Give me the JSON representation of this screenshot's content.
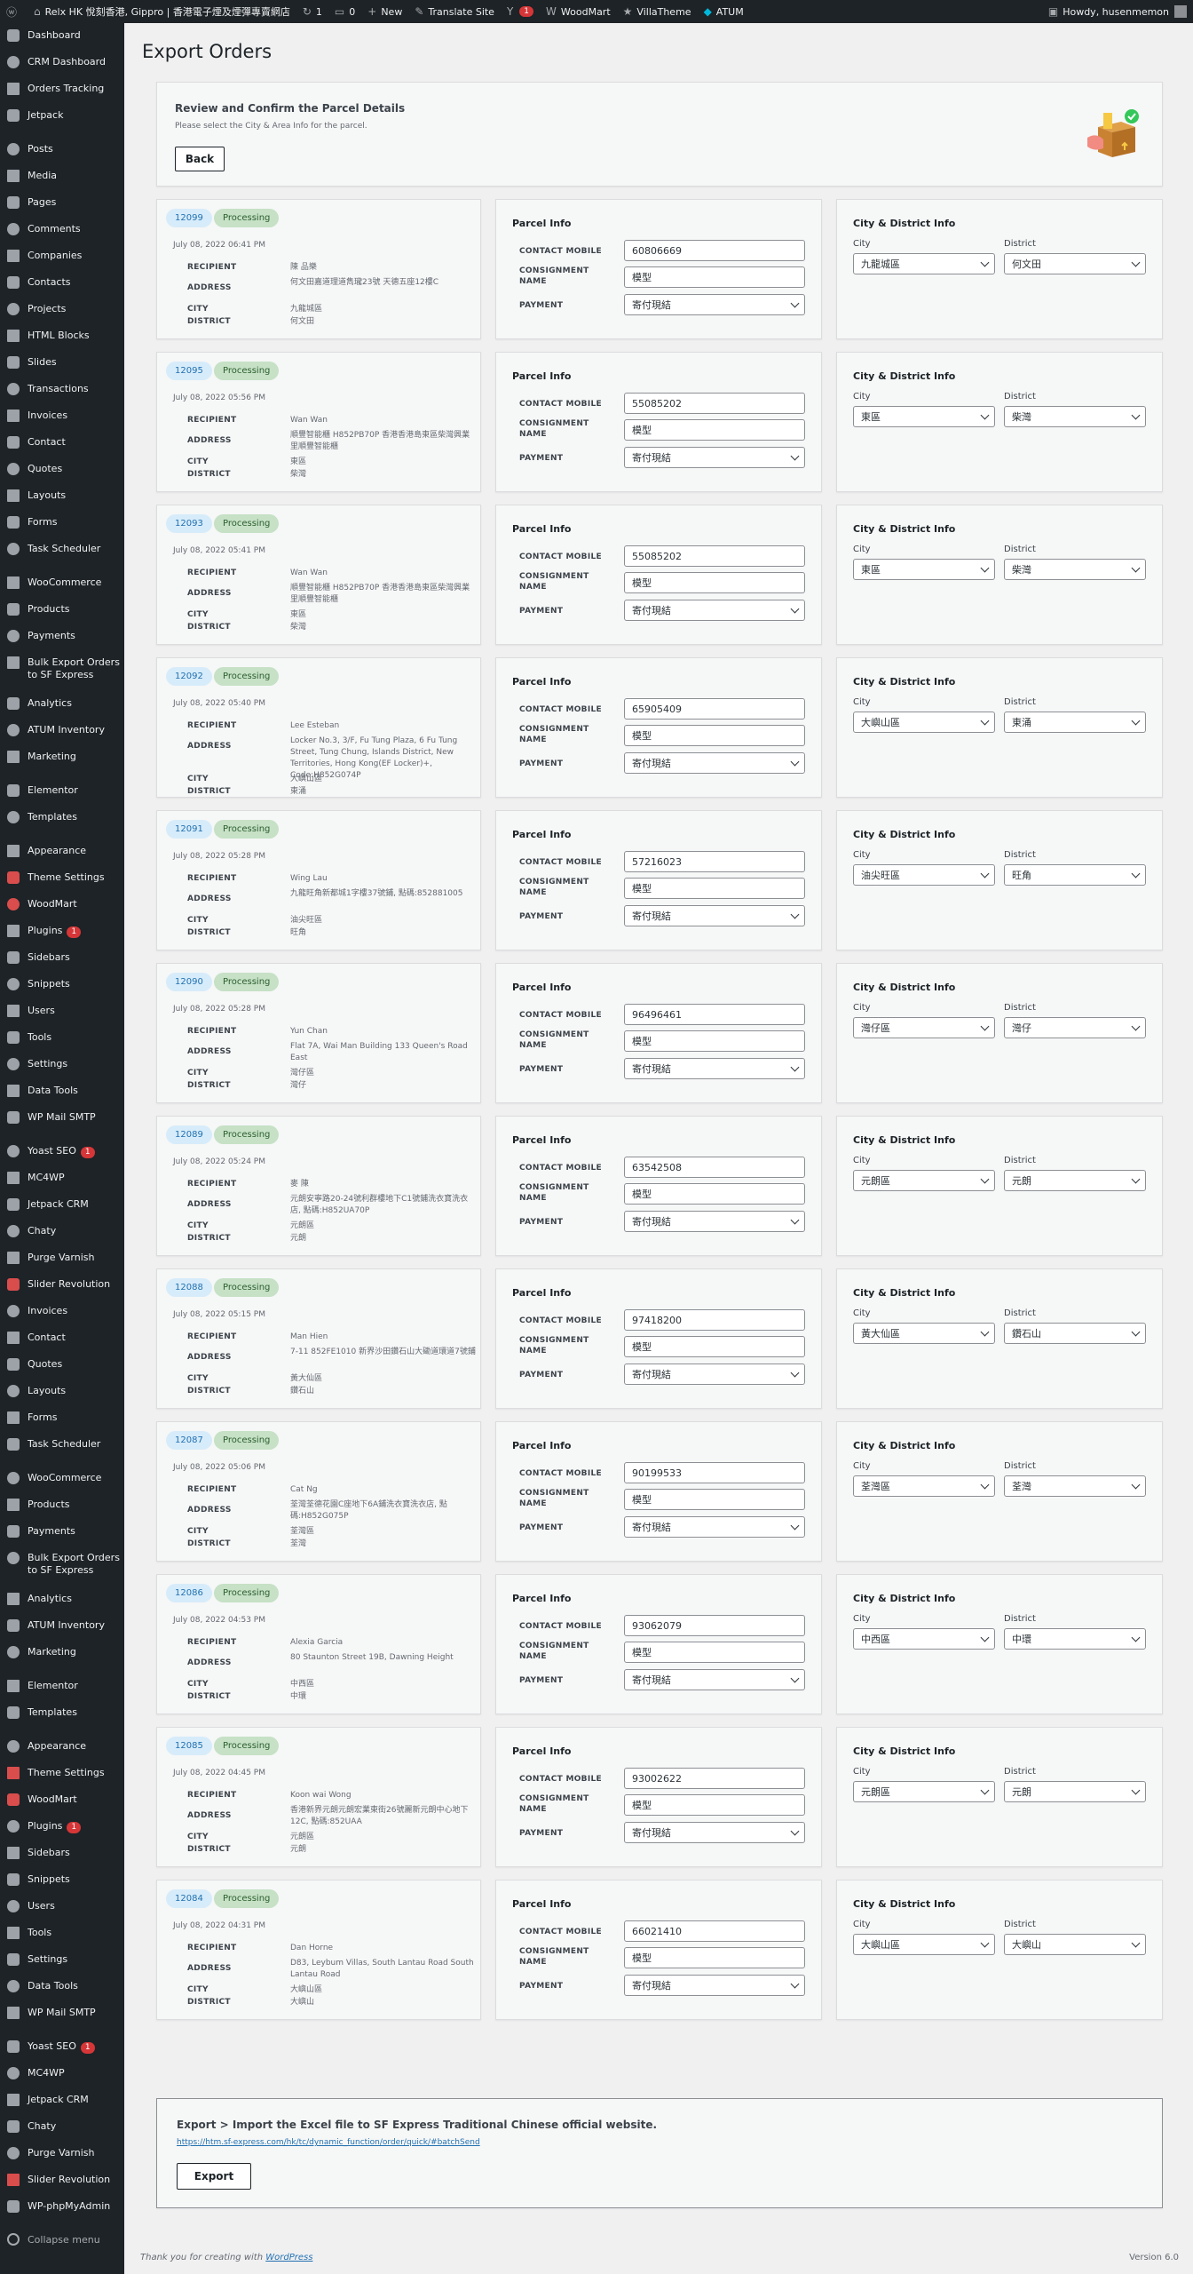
{
  "adminbar": {
    "site_name": "Relx HK 悅刻香港, Gippro | 香港電子煙及煙彈專賣網店",
    "updates_count": "1",
    "comments_count": "0",
    "new_label": "New",
    "translate_label": "Translate Site",
    "yoast_badge": "1",
    "woodmart_label": "WoodMart",
    "villatheme_label": "VillaTheme",
    "atum_label": "ATUM",
    "howdy": "Howdy, husenmemon"
  },
  "sidebar": {
    "items": [
      {
        "label": "Dashboard",
        "sep_before": false
      },
      {
        "label": "CRM Dashboard",
        "sep_before": false
      },
      {
        "label": "Orders Tracking",
        "sep_before": false
      },
      {
        "label": "Jetpack",
        "sep_before": false
      },
      {
        "label": "Posts",
        "sep_before": true
      },
      {
        "label": "Media",
        "sep_before": false
      },
      {
        "label": "Pages",
        "sep_before": false
      },
      {
        "label": "Comments",
        "sep_before": false
      },
      {
        "label": "Companies",
        "sep_before": false
      },
      {
        "label": "Contacts",
        "sep_before": false
      },
      {
        "label": "Projects",
        "sep_before": false
      },
      {
        "label": "HTML Blocks",
        "sep_before": false
      },
      {
        "label": "Slides",
        "sep_before": false
      },
      {
        "label": "Transactions",
        "sep_before": false
      },
      {
        "label": "Invoices",
        "sep_before": false
      },
      {
        "label": "Contact",
        "sep_before": false
      },
      {
        "label": "Quotes",
        "sep_before": false
      },
      {
        "label": "Layouts",
        "sep_before": false
      },
      {
        "label": "Forms",
        "sep_before": false
      },
      {
        "label": "Task Scheduler",
        "sep_before": false
      },
      {
        "label": "WooCommerce",
        "sep_before": true
      },
      {
        "label": "Products",
        "sep_before": false
      },
      {
        "label": "Payments",
        "sep_before": false
      },
      {
        "label": "Bulk Export Orders to SF Express",
        "sep_before": false,
        "tall": true
      },
      {
        "label": "Analytics",
        "sep_before": false
      },
      {
        "label": "ATUM Inventory",
        "sep_before": false
      },
      {
        "label": "Marketing",
        "sep_before": false
      },
      {
        "label": "Elementor",
        "sep_before": true
      },
      {
        "label": "Templates",
        "sep_before": false
      },
      {
        "label": "Appearance",
        "sep_before": true
      },
      {
        "label": "Theme Settings",
        "sep_before": false
      },
      {
        "label": "WoodMart",
        "sep_before": false
      },
      {
        "label": "Plugins",
        "sep_before": false,
        "badge": "1"
      },
      {
        "label": "Sidebars",
        "sep_before": false
      },
      {
        "label": "Snippets",
        "sep_before": false
      },
      {
        "label": "Users",
        "sep_before": false
      },
      {
        "label": "Tools",
        "sep_before": false
      },
      {
        "label": "Settings",
        "sep_before": false
      },
      {
        "label": "Data Tools",
        "sep_before": false
      },
      {
        "label": "WP Mail SMTP",
        "sep_before": false
      },
      {
        "label": "Yoast SEO",
        "sep_before": true,
        "badge": "1"
      },
      {
        "label": "MC4WP",
        "sep_before": false
      },
      {
        "label": "Jetpack CRM",
        "sep_before": false
      },
      {
        "label": "Chaty",
        "sep_before": false
      },
      {
        "label": "Purge Varnish",
        "sep_before": false
      },
      {
        "label": "Slider Revolution",
        "sep_before": false
      },
      {
        "label": "Invoices",
        "sep_before": false
      },
      {
        "label": "Contact",
        "sep_before": false
      },
      {
        "label": "Quotes",
        "sep_before": false
      },
      {
        "label": "Layouts",
        "sep_before": false
      },
      {
        "label": "Forms",
        "sep_before": false
      },
      {
        "label": "Task Scheduler",
        "sep_before": false
      },
      {
        "label": "WooCommerce",
        "sep_before": true
      },
      {
        "label": "Products",
        "sep_before": false
      },
      {
        "label": "Payments",
        "sep_before": false
      },
      {
        "label": "Bulk Export Orders to SF Express",
        "sep_before": false,
        "tall": true
      },
      {
        "label": "Analytics",
        "sep_before": false
      },
      {
        "label": "ATUM Inventory",
        "sep_before": false
      },
      {
        "label": "Marketing",
        "sep_before": false
      },
      {
        "label": "Elementor",
        "sep_before": true
      },
      {
        "label": "Templates",
        "sep_before": false
      },
      {
        "label": "Appearance",
        "sep_before": true
      },
      {
        "label": "Theme Settings",
        "sep_before": false
      },
      {
        "label": "WoodMart",
        "sep_before": false
      },
      {
        "label": "Plugins",
        "sep_before": false,
        "badge": "1"
      },
      {
        "label": "Sidebars",
        "sep_before": false
      },
      {
        "label": "Snippets",
        "sep_before": false
      },
      {
        "label": "Users",
        "sep_before": false
      },
      {
        "label": "Tools",
        "sep_before": false
      },
      {
        "label": "Settings",
        "sep_before": false
      },
      {
        "label": "Data Tools",
        "sep_before": false
      },
      {
        "label": "WP Mail SMTP",
        "sep_before": false
      },
      {
        "label": "Yoast SEO",
        "sep_before": true,
        "badge": "1"
      },
      {
        "label": "MC4WP",
        "sep_before": false
      },
      {
        "label": "Jetpack CRM",
        "sep_before": false
      },
      {
        "label": "Chaty",
        "sep_before": false
      },
      {
        "label": "Purge Varnish",
        "sep_before": false
      },
      {
        "label": "Slider Revolution",
        "sep_before": false
      },
      {
        "label": "WP-phpMyAdmin",
        "sep_before": false
      }
    ],
    "collapse_label": "Collapse menu"
  },
  "page": {
    "title": "Export Orders",
    "review_title": "Review and Confirm the Parcel Details",
    "review_sub": "Please select the City & Area Info for the parcel.",
    "back_label": "Back"
  },
  "labels": {
    "recipient": "RECIPIENT",
    "address": "ADDRESS",
    "city": "CITY",
    "district": "DISTRICT",
    "parcel_info": "Parcel Info",
    "contact_mobile": "CONTACT MOBILE",
    "consignment_name": "CONSIGNMENT NAME",
    "payment": "PAYMENT",
    "city_district_info": "City & District Info",
    "city_sub": "City",
    "district_sub": "District"
  },
  "orders": [
    {
      "id": "12099",
      "status": "Processing",
      "date": "July 08, 2022 06:41 PM",
      "recipient": "陳 品樂",
      "address": "何文田嘉道理道雋瓏23號 天德五座12樓C",
      "city": "九龍城區",
      "district": "何文田",
      "mobile": "60806669",
      "consignment": "模型",
      "payment": "寄付現結"
    },
    {
      "id": "12095",
      "status": "Processing",
      "date": "July 08, 2022 05:56 PM",
      "recipient": "Wan Wan",
      "address": "順豐智能櫃 H852PB70P 香港香港島東區柴灣興業里順豐智能櫃",
      "city": "東區",
      "district": "柴灣",
      "mobile": "55085202",
      "consignment": "模型",
      "payment": "寄付現結"
    },
    {
      "id": "12093",
      "status": "Processing",
      "date": "July 08, 2022 05:41 PM",
      "recipient": "Wan Wan",
      "address": "順豐智能櫃 H852PB70P 香港香港島東區柴灣興業里順豐智能櫃",
      "city": "東區",
      "district": "柴灣",
      "mobile": "55085202",
      "consignment": "模型",
      "payment": "寄付現結"
    },
    {
      "id": "12092",
      "status": "Processing",
      "date": "July 08, 2022 05:40 PM",
      "recipient": "Lee Esteban",
      "address": "Locker No.3, 3/F, Fu Tung Plaza, 6 Fu Tung Street, Tung Chung, Islands District, New Territories, Hong Kong(EF Locker)+, Code:H852G074P",
      "city": "大嶼山區",
      "district": "東涌",
      "mobile": "65905409",
      "consignment": "模型",
      "payment": "寄付現結"
    },
    {
      "id": "12091",
      "status": "Processing",
      "date": "July 08, 2022 05:28 PM",
      "recipient": "Wing Lau",
      "address": "九龍旺角新都城1字樓37號鋪, 點碼:852881005",
      "city": "油尖旺區",
      "district": "旺角",
      "mobile": "57216023",
      "consignment": "模型",
      "payment": "寄付現結"
    },
    {
      "id": "12090",
      "status": "Processing",
      "date": "July 08, 2022 05:28 PM",
      "recipient": "Yun Chan",
      "address": "Flat 7A, Wai Man Building 133 Queen's Road East",
      "city": "灣仔區",
      "district": "灣仔",
      "mobile": "96496461",
      "consignment": "模型",
      "payment": "寄付現結"
    },
    {
      "id": "12089",
      "status": "Processing",
      "date": "July 08, 2022 05:24 PM",
      "recipient": "麥 陳",
      "address": "元朗安寧路20-24號利群樓地下C1號鋪洗衣寶洗衣店, 點碼:H852UA70P",
      "city": "元朗區",
      "district": "元朗",
      "mobile": "63542508",
      "consignment": "模型",
      "payment": "寄付現結"
    },
    {
      "id": "12088",
      "status": "Processing",
      "date": "July 08, 2022 05:15 PM",
      "recipient": "Man Hien",
      "address": "7-11 852FE1010 新界沙田鑽石山大磡道環道7號鋪",
      "city": "黃大仙區",
      "district": "鑽石山",
      "mobile": "97418200",
      "consignment": "模型",
      "payment": "寄付現結"
    },
    {
      "id": "12087",
      "status": "Processing",
      "date": "July 08, 2022 05:06 PM",
      "recipient": "Cat Ng",
      "address": "荃灣荃德花園C座地下6A鋪洗衣寶洗衣店, 點碼:H852G075P",
      "city": "荃灣區",
      "district": "荃灣",
      "mobile": "90199533",
      "consignment": "模型",
      "payment": "寄付現結"
    },
    {
      "id": "12086",
      "status": "Processing",
      "date": "July 08, 2022 04:53 PM",
      "recipient": "Alexia Garcia",
      "address": "80 Staunton Street 19B, Dawning Height",
      "city": "中西區",
      "district": "中環",
      "mobile": "93062079",
      "consignment": "模型",
      "payment": "寄付現結"
    },
    {
      "id": "12085",
      "status": "Processing",
      "date": "July 08, 2022 04:45 PM",
      "recipient": "Koon wai Wong",
      "address": "香港新界元朗元朗宏業東街26號麗新元朗中心地下12C, 點碼:852UAA",
      "city": "元朗區",
      "district": "元朗",
      "mobile": "93002622",
      "consignment": "模型",
      "payment": "寄付現結"
    },
    {
      "id": "12084",
      "status": "Processing",
      "date": "July 08, 2022 04:31 PM",
      "recipient": "Dan Horne",
      "address": "D83, Leybum Villas, South Lantau Road South Lantau Road",
      "city": "大嶼山區",
      "district": "大嶼山",
      "mobile": "66021410",
      "consignment": "模型",
      "payment": "寄付現結"
    }
  ],
  "export": {
    "title": "Export > Import the Excel file to SF Express Traditional Chinese official website.",
    "link": "https://htm.sf-express.com/hk/tc/dynamic_function/order/quick/#batchSend",
    "button": "Export"
  },
  "footer": {
    "thanks": "Thank you for creating with",
    "wp": "WordPress",
    "version": "Version 6.0"
  }
}
